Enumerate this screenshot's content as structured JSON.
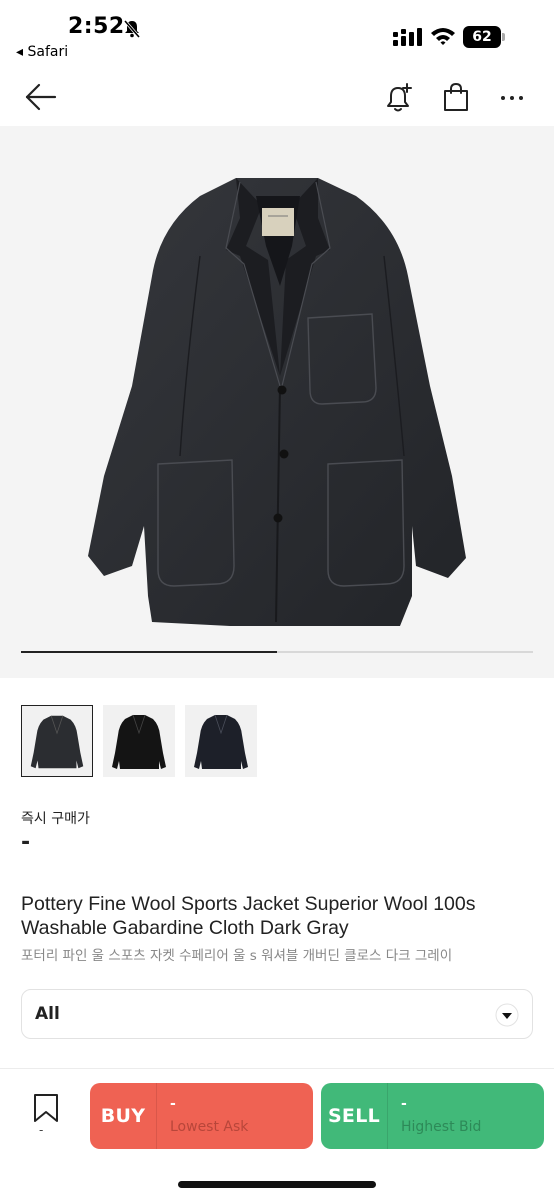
{
  "status_bar": {
    "time": "2:52",
    "back_app": "◂ Safari",
    "battery": "62"
  },
  "product": {
    "price_label": "즉시 구매가",
    "price_value": "-",
    "title_en": "Pottery Fine Wool Sports Jacket Superior Wool 100s Washable Gabardine Cloth Dark Gray",
    "title_ko": "포터리 파인 울 스포츠 자켓 수페리어 울 s 워셔블 개버딘 클로스 다크 그레이",
    "image_progress": 0.5,
    "thumbnails": [
      "dark-gray",
      "black",
      "navy"
    ],
    "selected_thumbnail": 0
  },
  "size_select": {
    "value": "All"
  },
  "bottom_bar": {
    "bookmark_count": "-",
    "buy": {
      "label": "BUY",
      "price": "-",
      "sub": "Lowest Ask"
    },
    "sell": {
      "label": "SELL",
      "price": "-",
      "sub": "Highest Bid"
    }
  },
  "icons": {
    "status": [
      "bell-off-icon",
      "signal-icon",
      "wifi-icon",
      "battery-icon"
    ],
    "nav": [
      "back-arrow-icon",
      "alert-add-icon",
      "shopping-bag-icon",
      "more-icon"
    ],
    "other": [
      "chevron-down-icon",
      "bookmark-icon"
    ]
  },
  "colors": {
    "buy": "#ef6253",
    "sell": "#41b979",
    "jacket_dark_gray": "#2b2d31",
    "jacket_black": "#141414",
    "jacket_navy": "#1d2029"
  }
}
